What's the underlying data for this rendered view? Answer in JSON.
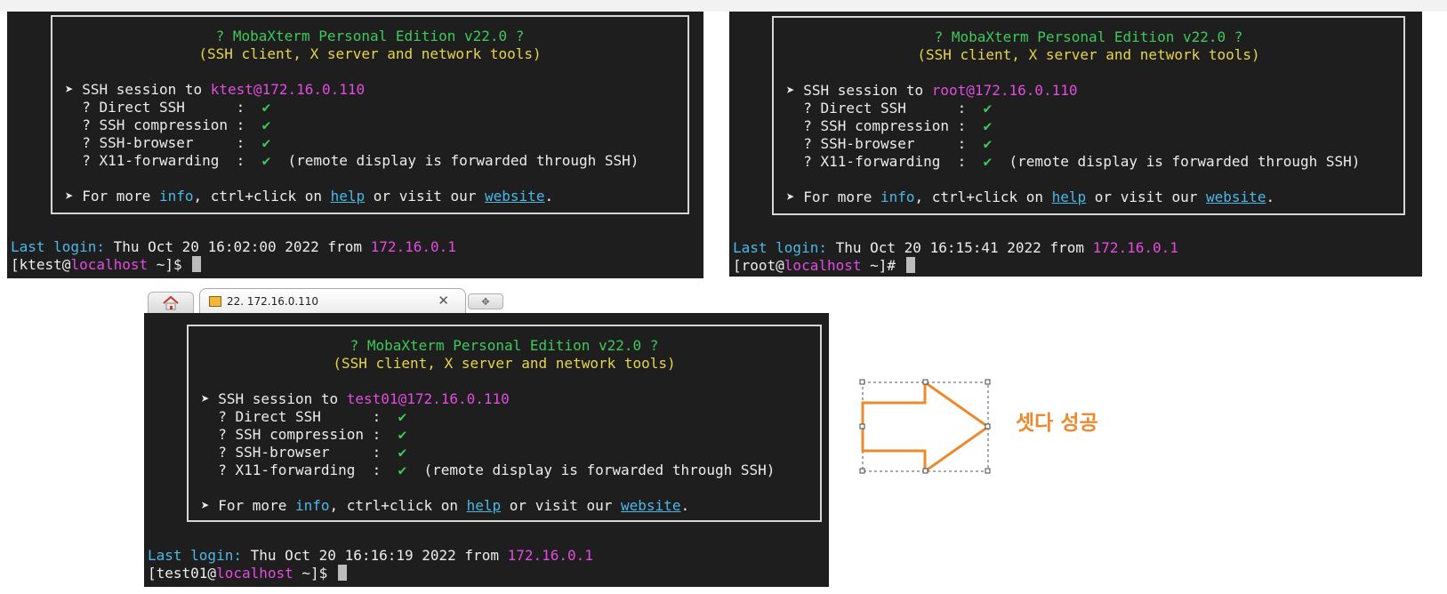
{
  "terminals": [
    {
      "id": "ktest",
      "banner": {
        "title": "? MobaXterm Personal Edition v22.0 ?",
        "subtitle": "(SSH client, X server and network tools)",
        "session_prefix": "➤ SSH session to ",
        "session_target": "ktest@172.16.0.110",
        "features": [
          {
            "label": "  ? Direct SSH      :  ",
            "mark": "✔",
            "note": ""
          },
          {
            "label": "  ? SSH compression :  ",
            "mark": "✔",
            "note": ""
          },
          {
            "label": "  ? SSH-browser     :  ",
            "mark": "✔",
            "note": ""
          },
          {
            "label": "  ? X11-forwarding  :  ",
            "mark": "✔",
            "note": "  (remote display is forwarded through SSH)"
          }
        ],
        "more_1": "➤ For more ",
        "more_info": "info",
        "more_2": ", ctrl+click on ",
        "more_help": "help",
        "more_3": " or visit our ",
        "more_website": "website",
        "more_4": "."
      },
      "last_login_label": "Last login:",
      "last_login_value": " Thu Oct 20 16:02:00 2022 from ",
      "last_login_ip": "172.16.0.1",
      "prompt_user": "[ktest@",
      "prompt_host": "localhost",
      "prompt_tail": " ~]$ "
    },
    {
      "id": "root",
      "banner": {
        "title": "? MobaXterm Personal Edition v22.0 ?",
        "subtitle": "(SSH client, X server and network tools)",
        "session_prefix": "➤ SSH session to ",
        "session_target": "root@172.16.0.110",
        "features": [
          {
            "label": "  ? Direct SSH      :  ",
            "mark": "✔",
            "note": ""
          },
          {
            "label": "  ? SSH compression :  ",
            "mark": "✔",
            "note": ""
          },
          {
            "label": "  ? SSH-browser     :  ",
            "mark": "✔",
            "note": ""
          },
          {
            "label": "  ? X11-forwarding  :  ",
            "mark": "✔",
            "note": "  (remote display is forwarded through SSH)"
          }
        ],
        "more_1": "➤ For more ",
        "more_info": "info",
        "more_2": ", ctrl+click on ",
        "more_help": "help",
        "more_3": " or visit our ",
        "more_website": "website",
        "more_4": "."
      },
      "last_login_label": "Last login:",
      "last_login_value": " Thu Oct 20 16:15:41 2022 from ",
      "last_login_ip": "172.16.0.1",
      "prompt_user": "[root@",
      "prompt_host": "localhost",
      "prompt_tail": " ~]# "
    },
    {
      "id": "test01",
      "banner": {
        "title": "? MobaXterm Personal Edition v22.0 ?",
        "subtitle": "(SSH client, X server and network tools)",
        "session_prefix": "➤ SSH session to ",
        "session_target": "test01@172.16.0.110",
        "features": [
          {
            "label": "  ? Direct SSH      :  ",
            "mark": "✔",
            "note": ""
          },
          {
            "label": "  ? SSH compression :  ",
            "mark": "✔",
            "note": ""
          },
          {
            "label": "  ? SSH-browser     :  ",
            "mark": "✔",
            "note": ""
          },
          {
            "label": "  ? X11-forwarding  :  ",
            "mark": "✔",
            "note": "  (remote display is forwarded through SSH)"
          }
        ],
        "more_1": "➤ For more ",
        "more_info": "info",
        "more_2": ", ctrl+click on ",
        "more_help": "help",
        "more_3": " or visit our ",
        "more_website": "website",
        "more_4": "."
      },
      "last_login_label": "Last login:",
      "last_login_value": " Thu Oct 20 16:16:19 2022 from ",
      "last_login_ip": "172.16.0.1",
      "prompt_user": "[test01@",
      "prompt_host": "localhost",
      "prompt_tail": " ~]$ "
    }
  ],
  "tabs": {
    "home_icon": "home-icon",
    "active_title": "22. 172.16.0.110",
    "close_glyph": "✕",
    "new_tab_glyph": "✥"
  },
  "annotation": {
    "label": "셋다 성공",
    "color": "#ec8a2f"
  },
  "colors": {
    "terminal_bg": "#1e1e1e",
    "green": "#3ec95a",
    "yellow": "#e8d44a",
    "magenta": "#e44be0",
    "cyan": "#4bb8e8"
  }
}
